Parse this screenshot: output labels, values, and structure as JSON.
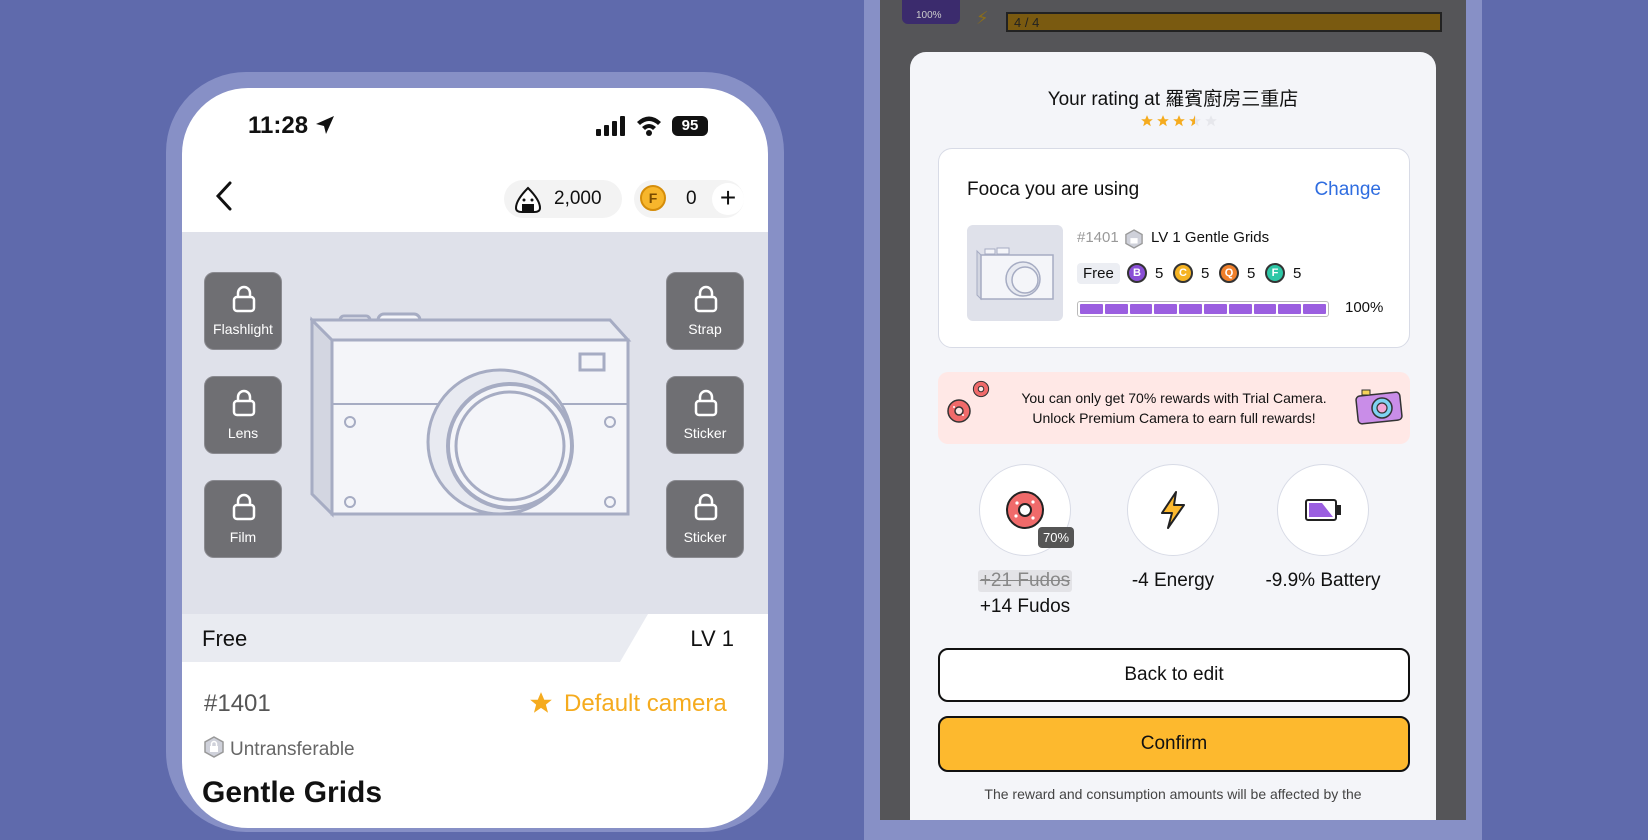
{
  "left": {
    "status": {
      "time": "11:28",
      "battery": "95"
    },
    "header": {
      "onigiri_count": "2,000",
      "coin_symbol": "F",
      "coin_count": "0",
      "add_symbol": "+"
    },
    "slots": {
      "flashlight": "Flashlight",
      "lens": "Lens",
      "film": "Film",
      "strap": "Strap",
      "sticker1": "Sticker",
      "sticker2": "Sticker"
    },
    "info_bar": {
      "free": "Free",
      "level": "LV 1"
    },
    "detail": {
      "id": "#1401",
      "default_label": "Default camera",
      "untransferable": "Untransferable",
      "name": "Gentle Grids"
    }
  },
  "right": {
    "background": {
      "thumb_percent": "100%",
      "energy_bar": "4 / 4"
    },
    "modal": {
      "title": "Your rating at 羅賓廚房三重店",
      "rating": 3.5,
      "using_card": {
        "heading": "Fooca you are using",
        "change": "Change",
        "id": "#1401",
        "level_name": "LV 1  Gentle Grids",
        "free": "Free",
        "stats": [
          {
            "letter": "B",
            "value": "5",
            "color": "#8a4fd6"
          },
          {
            "letter": "C",
            "value": "5",
            "color": "#f5b322"
          },
          {
            "letter": "Q",
            "value": "5",
            "color": "#f07f2a"
          },
          {
            "letter": "F",
            "value": "5",
            "color": "#2dc7a6"
          }
        ],
        "durability_percent": "100%"
      },
      "notice": {
        "line1": "You can only get 70% rewards with Trial Camera.",
        "line2": "Unlock Premium Camera to earn full rewards!"
      },
      "rewards": {
        "fudos_badge": "70%",
        "fudos_original": "+21 Fudos",
        "fudos_actual": "+14 Fudos",
        "energy": "-4 Energy",
        "battery": "-9.9% Battery"
      },
      "buttons": {
        "back": "Back to edit",
        "confirm": "Confirm"
      },
      "footnote": "The reward and consumption amounts will be affected by the"
    }
  }
}
